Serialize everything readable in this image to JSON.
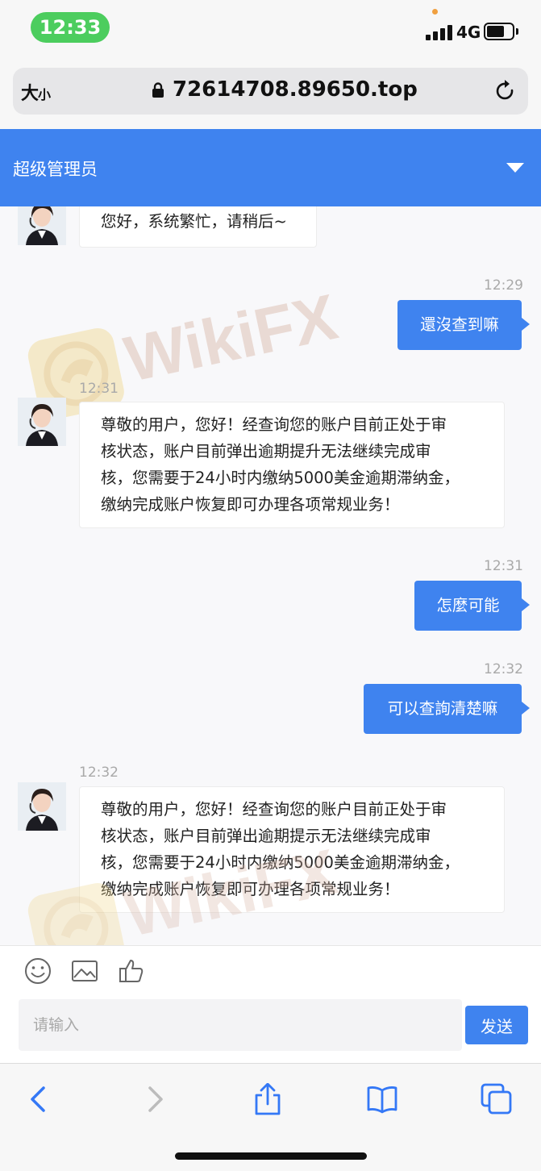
{
  "status_bar": {
    "time": "12:33",
    "network": "4G",
    "signal_bars": 4,
    "battery_level": 0.7,
    "colors": {
      "time_pill": "#4ccd5e"
    }
  },
  "browser": {
    "text_size_label_big": "大",
    "text_size_label_small": "小",
    "url": "72614708.89650.top"
  },
  "chat": {
    "title": "超级管理员",
    "accent_color": "#3f83ef",
    "messages": [
      {
        "from": "agent",
        "time": "",
        "lines": [
          "您好，系统繁忙，请稍后~"
        ]
      },
      {
        "from": "user",
        "time": "12:29",
        "text": "還沒查到嘛"
      },
      {
        "from": "agent",
        "time": "12:31",
        "lines": [
          "尊敬的用户，您好！经查询您的账户目前正处于审",
          "核状态，账户目前弹出逾期提升无法继续完成审",
          "核，您需要于24小时内缴纳5000美金逾期滞纳金，",
          "缴纳完成账户恢复即可办理各项常规业务！"
        ]
      },
      {
        "from": "user",
        "time": "12:31",
        "text": "怎麼可能"
      },
      {
        "from": "user",
        "time": "12:32",
        "text": "可以查詢清楚嘛"
      },
      {
        "from": "agent",
        "time": "12:32",
        "lines": [
          "尊敬的用户，您好！经查询您的账户目前正处于审",
          "核状态，账户目前弹出逾期提示无法继续完成审",
          "核，您需要于24小时内缴纳5000美金逾期滞纳金，",
          "缴纳完成账户恢复即可办理各项常规业务！"
        ]
      }
    ]
  },
  "watermark": {
    "text": "WikiFX"
  },
  "composer": {
    "placeholder": "请输入",
    "send_label": "发送",
    "tools": [
      "smiley-icon",
      "image-icon",
      "thumbs-up-icon"
    ]
  },
  "browser_nav": {
    "icons": [
      "back-icon",
      "forward-icon",
      "share-icon",
      "bookmarks-icon",
      "tabs-icon"
    ]
  }
}
